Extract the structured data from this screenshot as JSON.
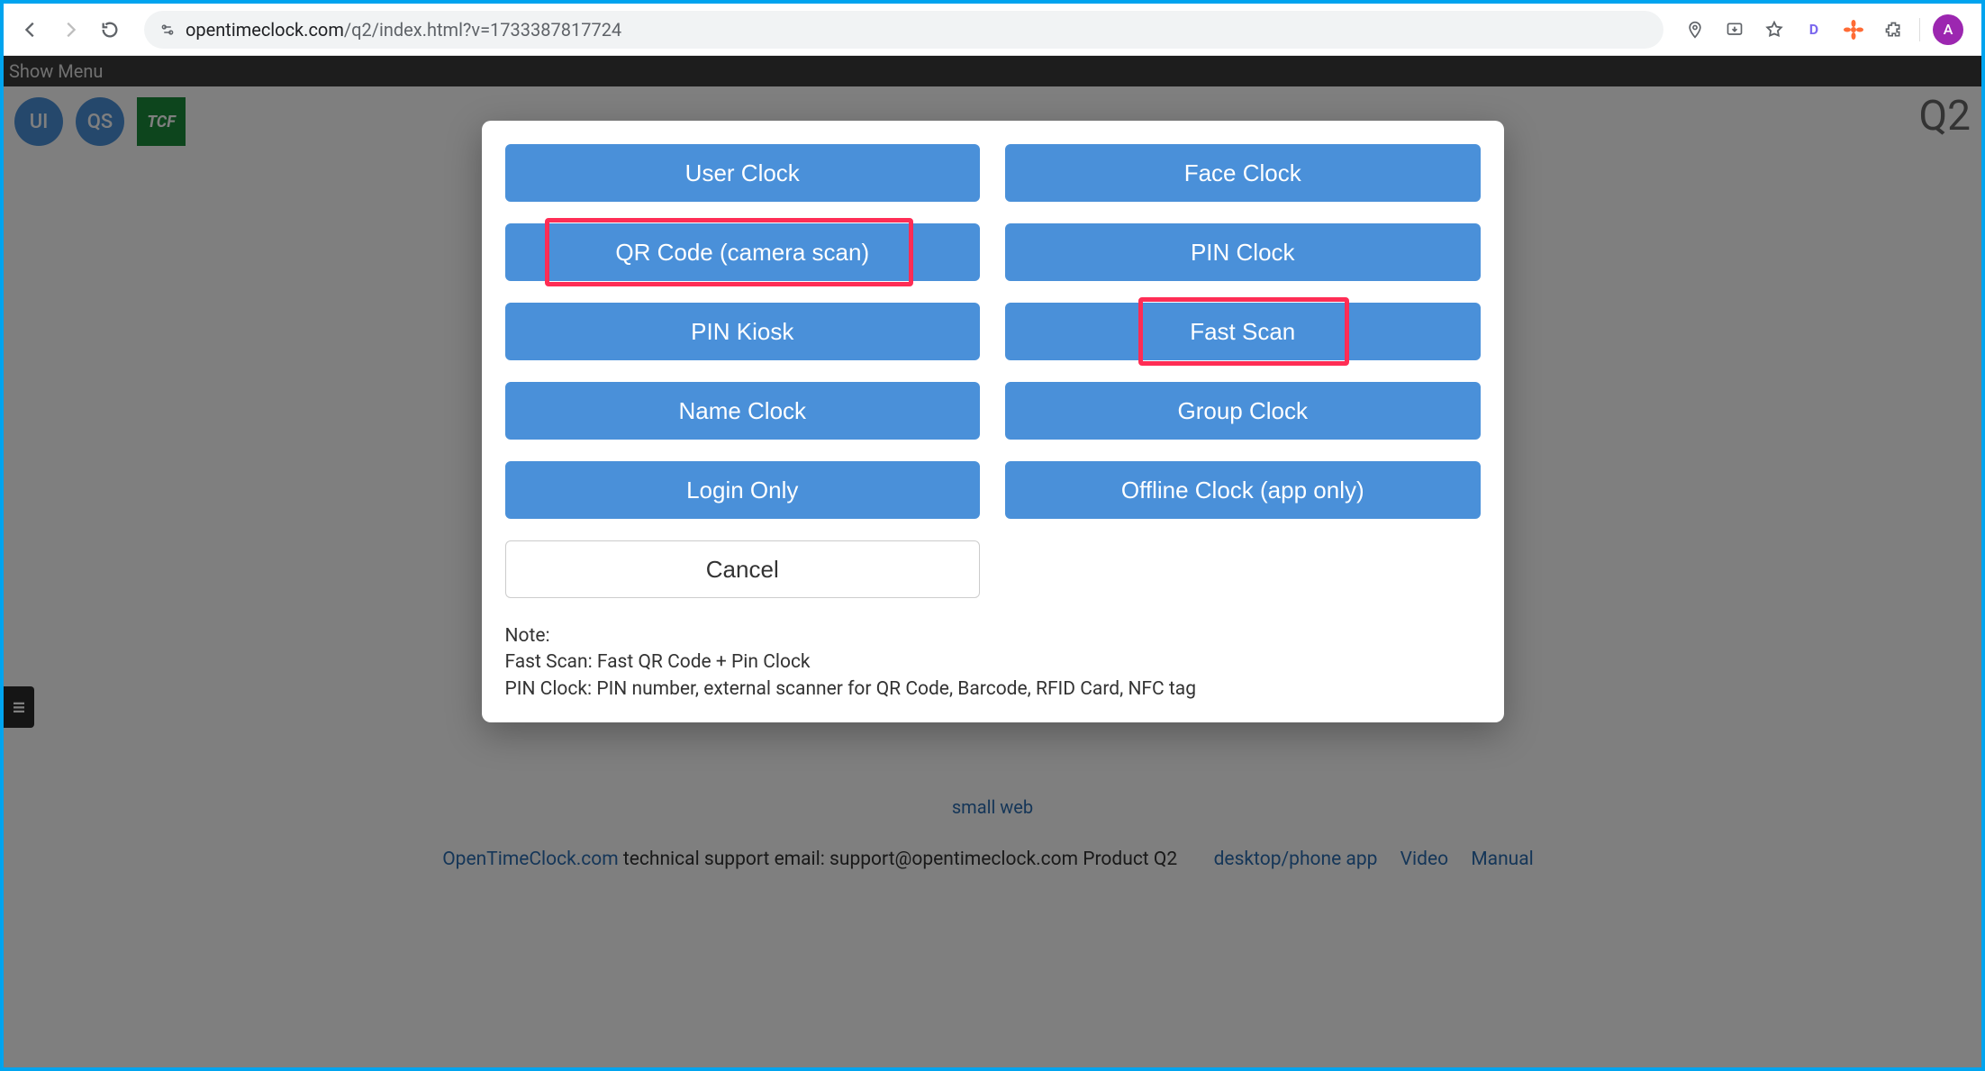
{
  "browser": {
    "url_domain": "opentimeclock.com",
    "url_path": "/q2/index.html?v=1733387817724",
    "profile_initial": "A",
    "ext_d_label": "D"
  },
  "page": {
    "menu_label": "Show Menu",
    "badge_ui": "UI",
    "badge_qs": "QS",
    "badge_tcf": "TCF",
    "q2_label": "Q2",
    "refresh": "refresh",
    "small_web": "small web",
    "footer_site": "OpenTimeClock.com",
    "footer_text": " technical support email: support@opentimeclock.com Product Q2",
    "footer_links": {
      "desktop": "desktop/phone app",
      "video": "Video",
      "manual": "Manual"
    }
  },
  "modal": {
    "buttons": {
      "user_clock": "User Clock",
      "face_clock": "Face Clock",
      "qr_code": "QR Code (camera scan)",
      "pin_clock": "PIN Clock",
      "pin_kiosk": "PIN Kiosk",
      "fast_scan": "Fast Scan",
      "name_clock": "Name Clock",
      "group_clock": "Group Clock",
      "login_only": "Login Only",
      "offline_clock": "Offline Clock (app only)",
      "cancel": "Cancel"
    },
    "note_title": "Note:",
    "note_line1": "Fast Scan: Fast QR Code + Pin Clock",
    "note_line2": "PIN Clock: PIN number, external scanner for QR Code, Barcode, RFID Card, NFC tag"
  }
}
